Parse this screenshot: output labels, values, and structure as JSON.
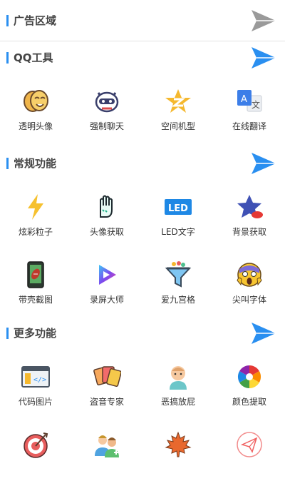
{
  "colors": {
    "accent": "#2a8ff0",
    "send_active": "#2a8ff0",
    "send_inactive": "#9a9a9a"
  },
  "sections": [
    {
      "title": "广告区域",
      "send_icon": "send-icon-gray"
    },
    {
      "title": "QQ工具",
      "send_icon": "send-icon-blue",
      "items": [
        {
          "label": "透明头像",
          "icon": "mask-icon"
        },
        {
          "label": "强制聊天",
          "icon": "robot-icon"
        },
        {
          "label": "空间机型",
          "icon": "qzone-star-icon"
        },
        {
          "label": "在线翻译",
          "icon": "translate-icon"
        }
      ]
    },
    {
      "title": "常规功能",
      "send_icon": "send-icon-blue",
      "items": [
        {
          "label": "炫彩粒子",
          "icon": "lightning-icon"
        },
        {
          "label": "头像获取",
          "icon": "hand-icon"
        },
        {
          "label": "LED文字",
          "icon": "led-icon"
        },
        {
          "label": "背景获取",
          "icon": "star-cloud-icon"
        },
        {
          "label": "带壳截图",
          "icon": "phone-icon"
        },
        {
          "label": "录屏大师",
          "icon": "play-icon"
        },
        {
          "label": "爱九宫格",
          "icon": "funnel-icon"
        },
        {
          "label": "尖叫字体",
          "icon": "scream-emoji-icon"
        }
      ]
    },
    {
      "title": "更多功能",
      "send_icon": "send-icon-blue",
      "items": [
        {
          "label": "代码图片",
          "icon": "code-window-icon"
        },
        {
          "label": "盗音专家",
          "icon": "cards-icon"
        },
        {
          "label": "恶搞放屁",
          "icon": "baby-icon"
        },
        {
          "label": "颜色提取",
          "icon": "color-wheel-icon"
        },
        {
          "label": "",
          "icon": "target-icon"
        },
        {
          "label": "",
          "icon": "people-icon"
        },
        {
          "label": "",
          "icon": "maple-leaf-icon"
        },
        {
          "label": "",
          "icon": "paper-plane-circle-icon"
        }
      ]
    }
  ]
}
